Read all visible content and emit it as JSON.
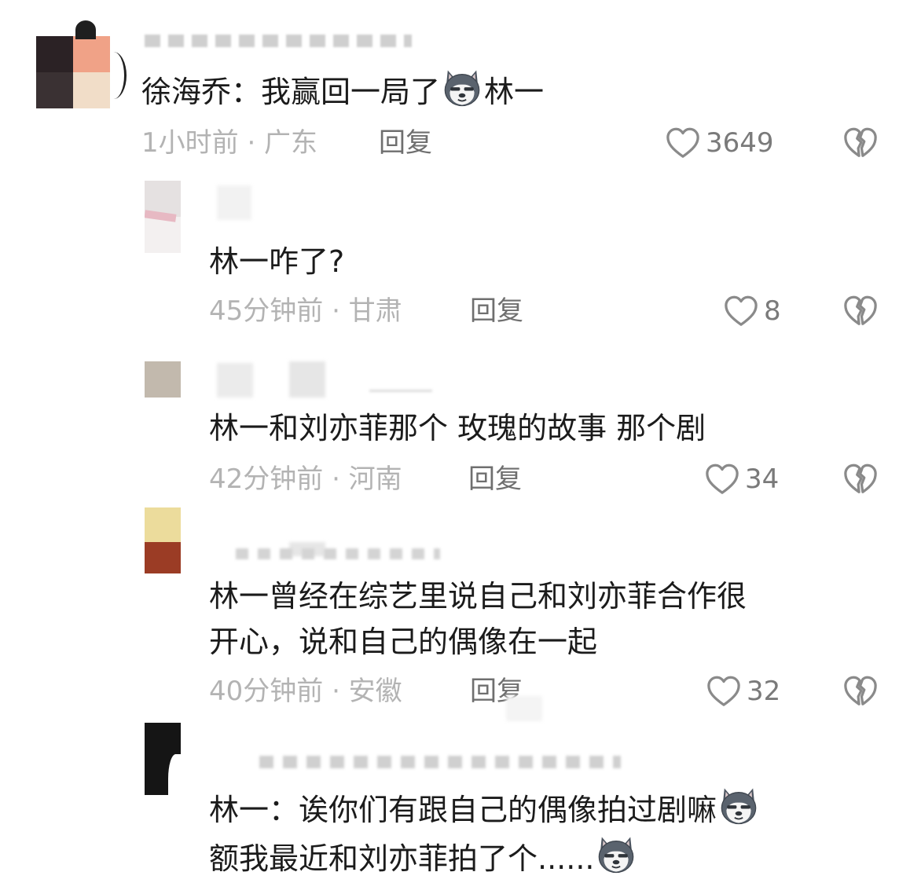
{
  "colors": {
    "text": "#1b1b1b",
    "meta": "#b3b3b3",
    "reply": "#6f6f6f",
    "count": "#7a7a7a",
    "icon": "#8a8a8a"
  },
  "icons": {
    "emoji": "husky-dog-emoji",
    "like": "heart-outline-icon",
    "dislike": "broken-heart-icon"
  },
  "comments": [
    {
      "line1_prefix": "徐海乔：我赢回一局了",
      "line1_suffix": "林一",
      "meta": "1小时前 · 广东",
      "reply": "回复",
      "likes": "3649"
    },
    {
      "line1": "林一咋了?",
      "meta": "45分钟前 · 甘肃",
      "reply": "回复",
      "likes": "8"
    },
    {
      "line1": "林一和刘亦菲那个  玫瑰的故事  那个剧",
      "meta": "42分钟前 · 河南",
      "reply": "回复",
      "likes": "34"
    },
    {
      "line1": "林一曾经在综艺里说自己和刘亦菲合作很",
      "line2": "开心，说和自己的偶像在一起",
      "meta": "40分钟前 · 安徽",
      "reply": "回复",
      "likes": "32"
    },
    {
      "line1": "林一：诶你们有跟自己的偶像拍过剧嘛",
      "line2": "额我最近和刘亦菲拍了个......"
    }
  ]
}
